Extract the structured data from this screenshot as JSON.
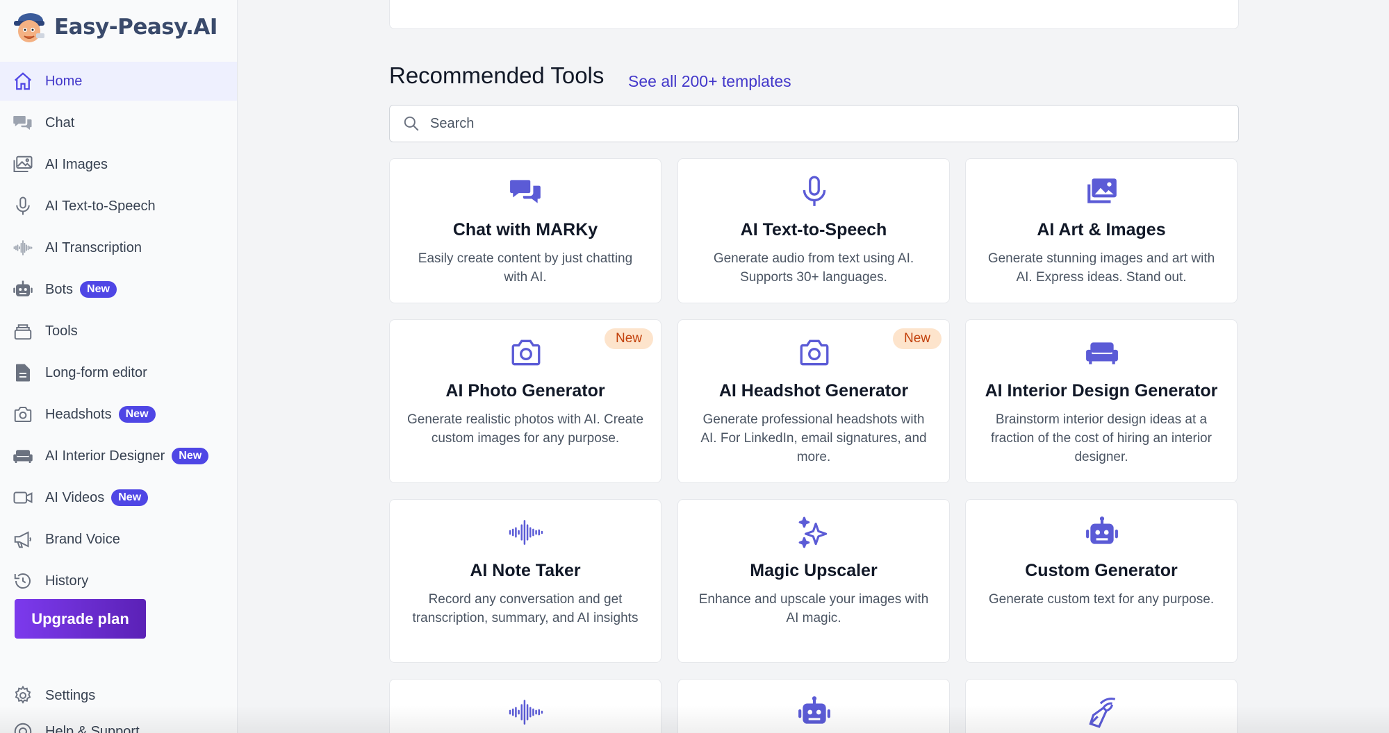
{
  "app": {
    "name": "Easy-Peasy.AI",
    "accent": "#4f46e5",
    "mascot_icon": "mascot-logo"
  },
  "sidebar": {
    "items": [
      {
        "label": "Home",
        "icon": "home-icon",
        "active": true
      },
      {
        "label": "Chat",
        "icon": "chat-bubbles-icon"
      },
      {
        "label": "AI Images",
        "icon": "images-icon"
      },
      {
        "label": "AI Text-to-Speech",
        "icon": "microphone-icon"
      },
      {
        "label": "AI Transcription",
        "icon": "waveform-icon"
      },
      {
        "label": "Bots",
        "icon": "robot-icon",
        "badge": "New"
      },
      {
        "label": "Tools",
        "icon": "stack-icon"
      },
      {
        "label": "Long-form editor",
        "icon": "document-icon"
      },
      {
        "label": "Headshots",
        "icon": "camera-icon",
        "badge": "New"
      },
      {
        "label": "AI Interior Designer",
        "icon": "sofa-icon",
        "badge": "New"
      },
      {
        "label": "AI Videos",
        "icon": "video-camera-icon",
        "badge": "New"
      },
      {
        "label": "Brand Voice",
        "icon": "megaphone-icon"
      },
      {
        "label": "History",
        "icon": "history-icon"
      }
    ],
    "upgrade_label": "Upgrade plan",
    "settings_label": "Settings",
    "help_label": "Help & Support"
  },
  "main": {
    "section_title": "Recommended Tools",
    "see_all_label": "See all 200+ templates",
    "search_placeholder": "Search",
    "new_badge": "New",
    "cards": [
      {
        "title": "Chat with MARKy",
        "desc": "Easily create content by just chatting with AI.",
        "icon": "chat-bubbles-icon"
      },
      {
        "title": "AI Text-to-Speech",
        "desc": "Generate audio from text using AI. Supports 30+ languages.",
        "icon": "microphone-icon"
      },
      {
        "title": "AI Art & Images",
        "desc": "Generate stunning images and art with AI. Express ideas. Stand out.",
        "icon": "images-icon"
      },
      {
        "title": "AI Photo Generator",
        "desc": "Generate realistic photos with AI. Create custom images for any purpose.",
        "icon": "camera-icon",
        "badge": "New"
      },
      {
        "title": "AI Headshot Generator",
        "desc": "Generate professional headshots with AI. For LinkedIn, email signatures, and more.",
        "icon": "camera-icon",
        "badge": "New"
      },
      {
        "title": "AI Interior Design Generator",
        "desc": "Brainstorm interior design ideas at a fraction of the cost of hiring an interior designer.",
        "icon": "sofa-icon"
      },
      {
        "title": "AI Note Taker",
        "desc": "Record any conversation and get transcription, summary, and AI insights",
        "icon": "waveform-icon"
      },
      {
        "title": "Magic Upscaler",
        "desc": "Enhance and upscale your images with AI magic.",
        "icon": "sparkles-icon"
      },
      {
        "title": "Custom Generator",
        "desc": "Generate custom text for any purpose.",
        "icon": "robot-icon"
      },
      {
        "title": "",
        "desc": "",
        "icon": "waveform-icon"
      },
      {
        "title": "",
        "desc": "",
        "icon": "robot-icon"
      },
      {
        "title": "",
        "desc": "",
        "icon": "pen-nib-icon"
      }
    ]
  }
}
